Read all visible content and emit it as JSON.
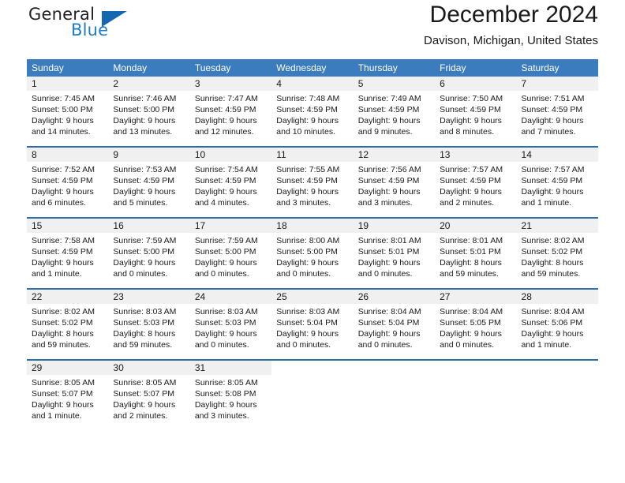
{
  "brand": {
    "word1": "General",
    "word2": "Blue",
    "logo_icon": "triangle-logo-icon",
    "accent_color": "#1567b0"
  },
  "header": {
    "title": "December 2024",
    "subtitle": "Davison, Michigan, United States"
  },
  "calendar": {
    "header_bg": "#3b7cbe",
    "row_divider_color": "#2e6da8",
    "daynum_band_color": "#f0f0f0",
    "weekdays": [
      "Sunday",
      "Monday",
      "Tuesday",
      "Wednesday",
      "Thursday",
      "Friday",
      "Saturday"
    ],
    "weeks": [
      [
        {
          "day": "1",
          "sunrise": "Sunrise: 7:45 AM",
          "sunset": "Sunset: 5:00 PM",
          "daylight1": "Daylight: 9 hours",
          "daylight2": "and 14 minutes."
        },
        {
          "day": "2",
          "sunrise": "Sunrise: 7:46 AM",
          "sunset": "Sunset: 5:00 PM",
          "daylight1": "Daylight: 9 hours",
          "daylight2": "and 13 minutes."
        },
        {
          "day": "3",
          "sunrise": "Sunrise: 7:47 AM",
          "sunset": "Sunset: 4:59 PM",
          "daylight1": "Daylight: 9 hours",
          "daylight2": "and 12 minutes."
        },
        {
          "day": "4",
          "sunrise": "Sunrise: 7:48 AM",
          "sunset": "Sunset: 4:59 PM",
          "daylight1": "Daylight: 9 hours",
          "daylight2": "and 10 minutes."
        },
        {
          "day": "5",
          "sunrise": "Sunrise: 7:49 AM",
          "sunset": "Sunset: 4:59 PM",
          "daylight1": "Daylight: 9 hours",
          "daylight2": "and 9 minutes."
        },
        {
          "day": "6",
          "sunrise": "Sunrise: 7:50 AM",
          "sunset": "Sunset: 4:59 PM",
          "daylight1": "Daylight: 9 hours",
          "daylight2": "and 8 minutes."
        },
        {
          "day": "7",
          "sunrise": "Sunrise: 7:51 AM",
          "sunset": "Sunset: 4:59 PM",
          "daylight1": "Daylight: 9 hours",
          "daylight2": "and 7 minutes."
        }
      ],
      [
        {
          "day": "8",
          "sunrise": "Sunrise: 7:52 AM",
          "sunset": "Sunset: 4:59 PM",
          "daylight1": "Daylight: 9 hours",
          "daylight2": "and 6 minutes."
        },
        {
          "day": "9",
          "sunrise": "Sunrise: 7:53 AM",
          "sunset": "Sunset: 4:59 PM",
          "daylight1": "Daylight: 9 hours",
          "daylight2": "and 5 minutes."
        },
        {
          "day": "10",
          "sunrise": "Sunrise: 7:54 AM",
          "sunset": "Sunset: 4:59 PM",
          "daylight1": "Daylight: 9 hours",
          "daylight2": "and 4 minutes."
        },
        {
          "day": "11",
          "sunrise": "Sunrise: 7:55 AM",
          "sunset": "Sunset: 4:59 PM",
          "daylight1": "Daylight: 9 hours",
          "daylight2": "and 3 minutes."
        },
        {
          "day": "12",
          "sunrise": "Sunrise: 7:56 AM",
          "sunset": "Sunset: 4:59 PM",
          "daylight1": "Daylight: 9 hours",
          "daylight2": "and 3 minutes."
        },
        {
          "day": "13",
          "sunrise": "Sunrise: 7:57 AM",
          "sunset": "Sunset: 4:59 PM",
          "daylight1": "Daylight: 9 hours",
          "daylight2": "and 2 minutes."
        },
        {
          "day": "14",
          "sunrise": "Sunrise: 7:57 AM",
          "sunset": "Sunset: 4:59 PM",
          "daylight1": "Daylight: 9 hours",
          "daylight2": "and 1 minute."
        }
      ],
      [
        {
          "day": "15",
          "sunrise": "Sunrise: 7:58 AM",
          "sunset": "Sunset: 4:59 PM",
          "daylight1": "Daylight: 9 hours",
          "daylight2": "and 1 minute."
        },
        {
          "day": "16",
          "sunrise": "Sunrise: 7:59 AM",
          "sunset": "Sunset: 5:00 PM",
          "daylight1": "Daylight: 9 hours",
          "daylight2": "and 0 minutes."
        },
        {
          "day": "17",
          "sunrise": "Sunrise: 7:59 AM",
          "sunset": "Sunset: 5:00 PM",
          "daylight1": "Daylight: 9 hours",
          "daylight2": "and 0 minutes."
        },
        {
          "day": "18",
          "sunrise": "Sunrise: 8:00 AM",
          "sunset": "Sunset: 5:00 PM",
          "daylight1": "Daylight: 9 hours",
          "daylight2": "and 0 minutes."
        },
        {
          "day": "19",
          "sunrise": "Sunrise: 8:01 AM",
          "sunset": "Sunset: 5:01 PM",
          "daylight1": "Daylight: 9 hours",
          "daylight2": "and 0 minutes."
        },
        {
          "day": "20",
          "sunrise": "Sunrise: 8:01 AM",
          "sunset": "Sunset: 5:01 PM",
          "daylight1": "Daylight: 8 hours",
          "daylight2": "and 59 minutes."
        },
        {
          "day": "21",
          "sunrise": "Sunrise: 8:02 AM",
          "sunset": "Sunset: 5:02 PM",
          "daylight1": "Daylight: 8 hours",
          "daylight2": "and 59 minutes."
        }
      ],
      [
        {
          "day": "22",
          "sunrise": "Sunrise: 8:02 AM",
          "sunset": "Sunset: 5:02 PM",
          "daylight1": "Daylight: 8 hours",
          "daylight2": "and 59 minutes."
        },
        {
          "day": "23",
          "sunrise": "Sunrise: 8:03 AM",
          "sunset": "Sunset: 5:03 PM",
          "daylight1": "Daylight: 8 hours",
          "daylight2": "and 59 minutes."
        },
        {
          "day": "24",
          "sunrise": "Sunrise: 8:03 AM",
          "sunset": "Sunset: 5:03 PM",
          "daylight1": "Daylight: 9 hours",
          "daylight2": "and 0 minutes."
        },
        {
          "day": "25",
          "sunrise": "Sunrise: 8:03 AM",
          "sunset": "Sunset: 5:04 PM",
          "daylight1": "Daylight: 9 hours",
          "daylight2": "and 0 minutes."
        },
        {
          "day": "26",
          "sunrise": "Sunrise: 8:04 AM",
          "sunset": "Sunset: 5:04 PM",
          "daylight1": "Daylight: 9 hours",
          "daylight2": "and 0 minutes."
        },
        {
          "day": "27",
          "sunrise": "Sunrise: 8:04 AM",
          "sunset": "Sunset: 5:05 PM",
          "daylight1": "Daylight: 9 hours",
          "daylight2": "and 0 minutes."
        },
        {
          "day": "28",
          "sunrise": "Sunrise: 8:04 AM",
          "sunset": "Sunset: 5:06 PM",
          "daylight1": "Daylight: 9 hours",
          "daylight2": "and 1 minute."
        }
      ],
      [
        {
          "day": "29",
          "sunrise": "Sunrise: 8:05 AM",
          "sunset": "Sunset: 5:07 PM",
          "daylight1": "Daylight: 9 hours",
          "daylight2": "and 1 minute."
        },
        {
          "day": "30",
          "sunrise": "Sunrise: 8:05 AM",
          "sunset": "Sunset: 5:07 PM",
          "daylight1": "Daylight: 9 hours",
          "daylight2": "and 2 minutes."
        },
        {
          "day": "31",
          "sunrise": "Sunrise: 8:05 AM",
          "sunset": "Sunset: 5:08 PM",
          "daylight1": "Daylight: 9 hours",
          "daylight2": "and 3 minutes."
        },
        {
          "day": "",
          "sunrise": "",
          "sunset": "",
          "daylight1": "",
          "daylight2": ""
        },
        {
          "day": "",
          "sunrise": "",
          "sunset": "",
          "daylight1": "",
          "daylight2": ""
        },
        {
          "day": "",
          "sunrise": "",
          "sunset": "",
          "daylight1": "",
          "daylight2": ""
        },
        {
          "day": "",
          "sunrise": "",
          "sunset": "",
          "daylight1": "",
          "daylight2": ""
        }
      ]
    ]
  }
}
